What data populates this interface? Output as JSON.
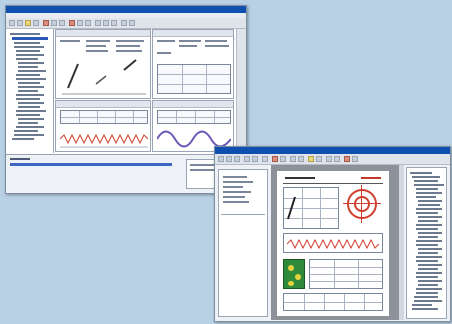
{
  "screenshots": {
    "first": {
      "title_text": ""
    },
    "second": {
      "title_text": ""
    }
  },
  "colors": {
    "background": "#b9d1e4",
    "titlebar": "#0e4fb0",
    "accent_red": "#d04030",
    "accent_blue": "#3b66c4"
  }
}
